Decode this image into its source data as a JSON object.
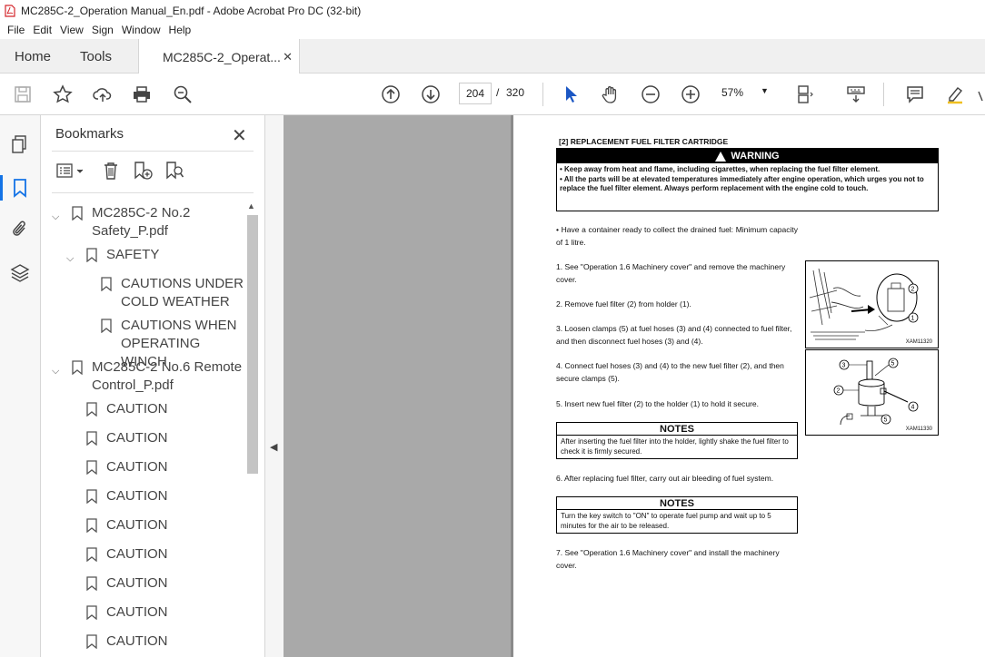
{
  "window": {
    "title": "MC285C-2_Operation Manual_En.pdf - Adobe Acrobat Pro DC (32-bit)"
  },
  "menu": [
    "File",
    "Edit",
    "View",
    "Sign",
    "Window",
    "Help"
  ],
  "tabs": {
    "home": "Home",
    "tools": "Tools",
    "document": "MC285C-2_Operat..."
  },
  "toolbar": {
    "current_page": "204",
    "separator": "/",
    "total_pages": "320",
    "zoom": "57%"
  },
  "bookmarks": {
    "title": "Bookmarks",
    "items": [
      {
        "label": "MC285C-2 No.2 Safety_P.pdf"
      },
      {
        "label": "SAFETY"
      },
      {
        "label": "CAUTIONS UNDER COLD WEATHER"
      },
      {
        "label": "CAUTIONS WHEN OPERATING WINCH"
      },
      {
        "label": "MC285C-2 No.6 Remote Control_P.pdf"
      },
      {
        "label": "CAUTION"
      },
      {
        "label": "CAUTION"
      },
      {
        "label": "CAUTION"
      },
      {
        "label": "CAUTION"
      },
      {
        "label": "CAUTION"
      },
      {
        "label": "CAUTION"
      },
      {
        "label": "CAUTION"
      },
      {
        "label": "CAUTION"
      },
      {
        "label": "CAUTION"
      }
    ]
  },
  "page": {
    "heading": "[2] REPLACEMENT FUEL FILTER CARTRIDGE",
    "warning_title": "WARNING",
    "warning_lines": [
      "• Keep away from heat and flame, including cigarettes, when replacing the fuel filter element.",
      "• All the parts will be at elevated temperatures immediately after engine operation, which urges you not to replace the fuel filter element. Always perform replacement with the engine cold to touch."
    ],
    "intro": "• Have a container ready to collect the drained fuel: Minimum capacity of 1 litre.",
    "steps": [
      "1. See \"Operation 1.6 Machinery cover\" and remove the machinery cover.",
      "2. Remove fuel filter (2) from holder (1).",
      "3. Loosen clamps (5) at fuel hoses (3) and (4) connected to fuel filter, and then disconnect fuel hoses (3) and (4).",
      "4. Connect fuel hoses (3) and (4) to the new fuel filter (2), and then secure clamps (5).",
      "5. Insert new fuel filter (2) to the holder (1) to hold it secure.",
      "6. After replacing fuel filter, carry out air bleeding of fuel system.",
      "7. See \"Operation 1.6 Machinery cover\" and install the machinery cover."
    ],
    "notes1_title": "NOTES",
    "notes1_text": "After inserting the fuel filter into the holder, lightly shake the fuel filter to check it is firmly secured.",
    "notes2_title": "NOTES",
    "notes2_text": "Turn the key switch to \"ON\" to operate fuel pump and wait up to 5 minutes for the air to be released.",
    "fig1_caption": "XAM11320",
    "fig2_caption": "XAM11330",
    "fig_labels": [
      "1",
      "2",
      "3",
      "4",
      "5",
      "5"
    ]
  }
}
